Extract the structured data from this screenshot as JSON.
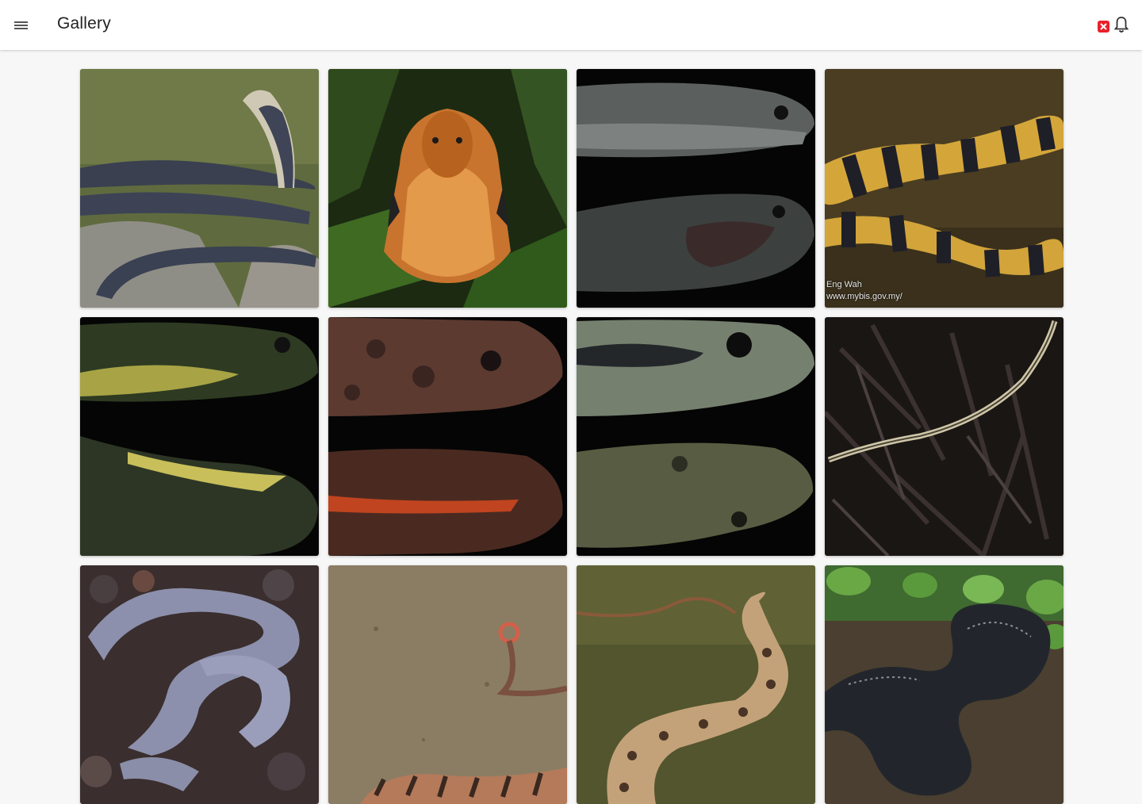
{
  "appbar": {
    "title": "Gallery",
    "menu_icon": "hamburger-menu-icon",
    "status_icon": "red-badge-icon",
    "notification_icon": "bell-icon",
    "accent_color": "#e8202a"
  },
  "gallery": {
    "tiles": [
      {
        "name": "snake-photo-cobra-rocks",
        "row": 1,
        "col": 1
      },
      {
        "name": "snake-photo-orange-cobra-hood",
        "row": 1,
        "col": 2
      },
      {
        "name": "snake-photo-grey-heads-black",
        "row": 1,
        "col": 3
      },
      {
        "name": "snake-photo-banded-krait",
        "row": 1,
        "col": 4,
        "credit_lines": [
          "Eng Wah",
          "www.mybis.gov.my/"
        ]
      },
      {
        "name": "snake-photo-yellow-green-head",
        "row": 2,
        "col": 1
      },
      {
        "name": "snake-photo-brown-spotted-head",
        "row": 2,
        "col": 2
      },
      {
        "name": "snake-photo-olive-heads",
        "row": 2,
        "col": 3
      },
      {
        "name": "snake-photo-slender-grass-snake",
        "row": 2,
        "col": 4
      },
      {
        "name": "snake-photo-sea-snake",
        "row": 3,
        "col": 1
      },
      {
        "name": "snake-photo-sand-ground",
        "row": 3,
        "col": 2
      },
      {
        "name": "snake-photo-spotted-moss",
        "row": 3,
        "col": 3
      },
      {
        "name": "snake-photo-dark-leaves",
        "row": 3,
        "col": 4
      }
    ]
  }
}
